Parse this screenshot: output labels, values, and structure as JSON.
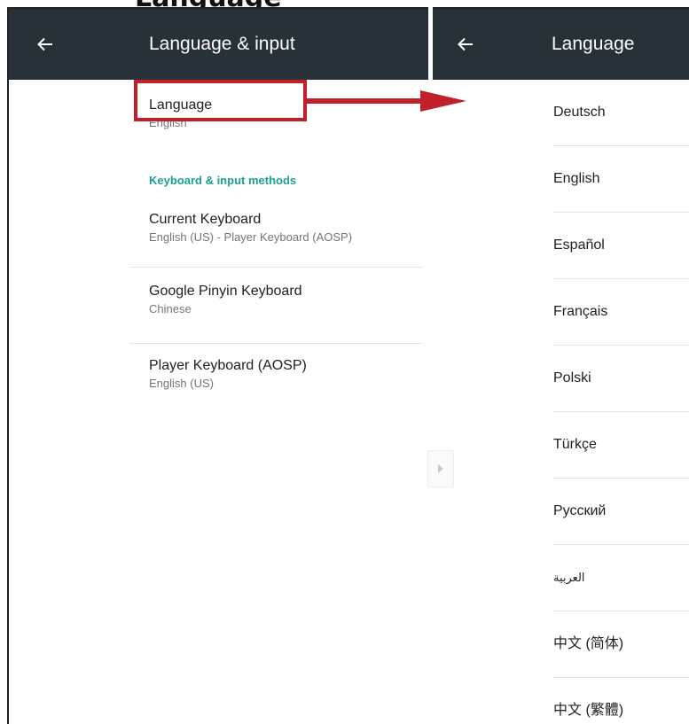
{
  "page_heading": "Language",
  "left_panel": {
    "title": "Language & input",
    "back_icon": "back-arrow-icon",
    "language_item": {
      "label": "Language",
      "summary": "English"
    },
    "section_header": "Keyboard & input methods",
    "keyboards": [
      {
        "label": "Current Keyboard",
        "summary": "English (US) - Player Keyboard (AOSP)"
      },
      {
        "label": "Google Pinyin Keyboard",
        "summary": "Chinese"
      },
      {
        "label": "Player Keyboard (AOSP)",
        "summary": "English (US)"
      }
    ]
  },
  "right_panel": {
    "title": "Language",
    "back_icon": "back-arrow-icon",
    "languages": [
      "Deutsch",
      "English",
      "Español",
      "Français",
      "Polski",
      "Türkçe",
      "Русский",
      "العربية",
      "中文 (简体)",
      "中文 (繁體)"
    ]
  },
  "colors": {
    "appbar": "#263238",
    "accent": "#1aa08f",
    "annotation": "#c0202a"
  }
}
